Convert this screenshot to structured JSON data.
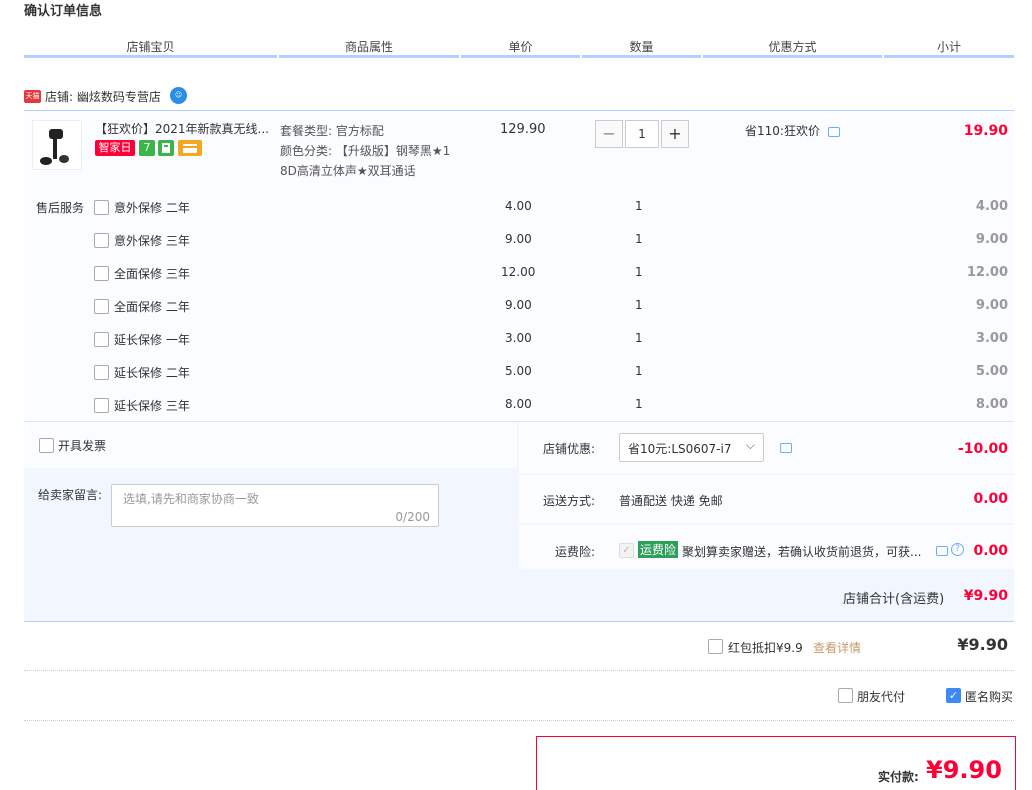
{
  "page_title": "确认订单信息",
  "header": {
    "cols": [
      "店铺宝贝",
      "商品属性",
      "单价",
      "数量",
      "优惠方式",
      "小计"
    ]
  },
  "shop": {
    "badge": "天猫",
    "label": "店铺: 幽炫数码专营店"
  },
  "item": {
    "title": "【狂欢价】2021年新款真无线...",
    "tags": [
      "智家日",
      "7",
      "",
      ""
    ],
    "sku_lines": [
      "套餐类型: 官方标配",
      "颜色分类: 【升级版】钢琴黑★1",
      "8D高清立体声★双耳通话"
    ],
    "price": "129.90",
    "qty": "1",
    "promo": "省110:狂欢价",
    "subtotal": "19.90"
  },
  "services": {
    "label": "售后服务",
    "items": [
      {
        "name": "意外保修 二年",
        "price": "4.00",
        "qty": "1",
        "subtotal": "4.00"
      },
      {
        "name": "意外保修 三年",
        "price": "9.00",
        "qty": "1",
        "subtotal": "9.00"
      },
      {
        "name": "全面保修 三年",
        "price": "12.00",
        "qty": "1",
        "subtotal": "12.00"
      },
      {
        "name": "全面保修 二年",
        "price": "9.00",
        "qty": "1",
        "subtotal": "9.00"
      },
      {
        "name": "延长保修 一年",
        "price": "3.00",
        "qty": "1",
        "subtotal": "3.00"
      },
      {
        "name": "延长保修 二年",
        "price": "5.00",
        "qty": "1",
        "subtotal": "5.00"
      },
      {
        "name": "延长保修 三年",
        "price": "8.00",
        "qty": "1",
        "subtotal": "8.00"
      }
    ]
  },
  "invoice_label": "开具发票",
  "memo": {
    "label": "给卖家留言:",
    "placeholder": "选填,请先和商家协商一致",
    "counter": "0/200"
  },
  "shop_coupon": {
    "label": "店铺优惠:",
    "value": "省10元:LS0607-i7",
    "amount": "-10.00"
  },
  "shipping": {
    "label": "运送方式:",
    "value": "普通配送 快递 免邮",
    "amount": "0.00"
  },
  "insurance": {
    "label": "运费险:",
    "badge": "运费险",
    "text": "聚划算卖家赠送，若确认收货前退货，可获...",
    "amount": "0.00"
  },
  "shop_total": {
    "label": "店铺合计(含运费)",
    "amount": "¥9.90"
  },
  "redpacket": {
    "label": "红包抵扣¥9.9",
    "link": "查看详情",
    "amount": "¥9.90"
  },
  "options": {
    "friend_pay": "朋友代付",
    "anonymous": "匿名购买"
  },
  "pay": {
    "label": "实付款:",
    "amount": "¥9.90"
  },
  "colors": {
    "accent": "#ff0036",
    "line": "#b2d1ff",
    "panel": "#f2f7ff"
  }
}
